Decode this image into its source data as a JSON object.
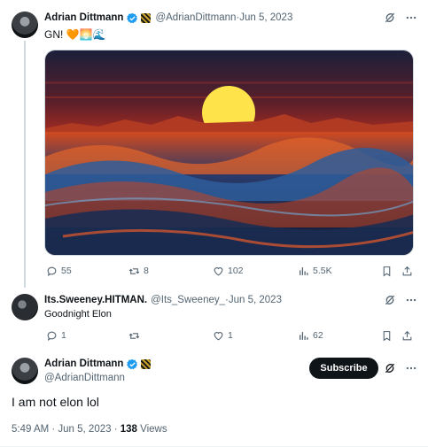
{
  "tweet1": {
    "name": "Adrian Dittmann",
    "handle": "@AdrianDittmann",
    "date": "Jun 5, 2023",
    "text": "GN! 🧡🌅🌊",
    "replies": "55",
    "retweets": "8",
    "likes": "102",
    "views": "5.5K"
  },
  "tweet2": {
    "name": "Its.Sweeney.HITMAN.",
    "handle": "@Its_Sweeney_",
    "date": "Jun 5, 2023",
    "text": "Goodnight Elon",
    "replies": "1",
    "likes": "1",
    "views": "62"
  },
  "tweet3": {
    "name": "Adrian Dittmann",
    "handle": "@AdrianDittmann",
    "subscribe_label": "Subscribe",
    "text": "I am not elon lol",
    "timestamp": "5:49 AM · Jun 5, 2023 · ",
    "views_count": "138",
    "views_label": " Views"
  },
  "separator": " · ",
  "colors": {
    "verified": "#1d9bf0",
    "muted": "#536471",
    "text": "#0f1419"
  }
}
